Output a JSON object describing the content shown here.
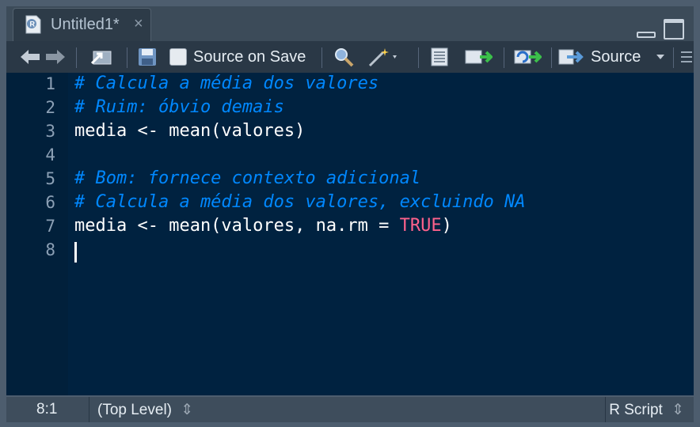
{
  "tab": {
    "title": "Untitled1*",
    "close": "×",
    "icon": "r-file-icon"
  },
  "toolbar": {
    "source_on_save_label": "Source on Save",
    "source_on_save_checked": false,
    "source_label": "Source",
    "icons": [
      "back-arrow-icon",
      "forward-arrow-icon",
      "show-in-window-icon",
      "save-icon",
      "search-icon",
      "magic-wand-icon",
      "compile-report-icon",
      "run-lines-icon",
      "rerun-icon",
      "source-icon",
      "outline-icon"
    ]
  },
  "editor": {
    "lines": [
      {
        "n": "1",
        "text": "# Calcula a média dos valores",
        "kind": "comment"
      },
      {
        "n": "2",
        "text": "# Ruim: óbvio demais",
        "kind": "comment"
      },
      {
        "n": "3",
        "text": "media <- mean(valores)",
        "kind": "code"
      },
      {
        "n": "4",
        "text": "",
        "kind": "code"
      },
      {
        "n": "5",
        "text": "# Bom: fornece contexto adicional",
        "kind": "comment"
      },
      {
        "n": "6",
        "text": "# Calcula a média dos valores, excluindo NA",
        "kind": "comment"
      },
      {
        "n": "7",
        "pre": "media <- mean(valores, na.rm = ",
        "const": "TRUE",
        "post": ")",
        "kind": "mixed"
      },
      {
        "n": "8",
        "text": "",
        "kind": "code"
      }
    ]
  },
  "status": {
    "position": "8:1",
    "scope": "(Top Level)",
    "filetype": "R Script"
  },
  "colors": {
    "background": "#002240",
    "comment": "#0088ff",
    "constant": "#ff628c",
    "text": "#ffffff"
  }
}
